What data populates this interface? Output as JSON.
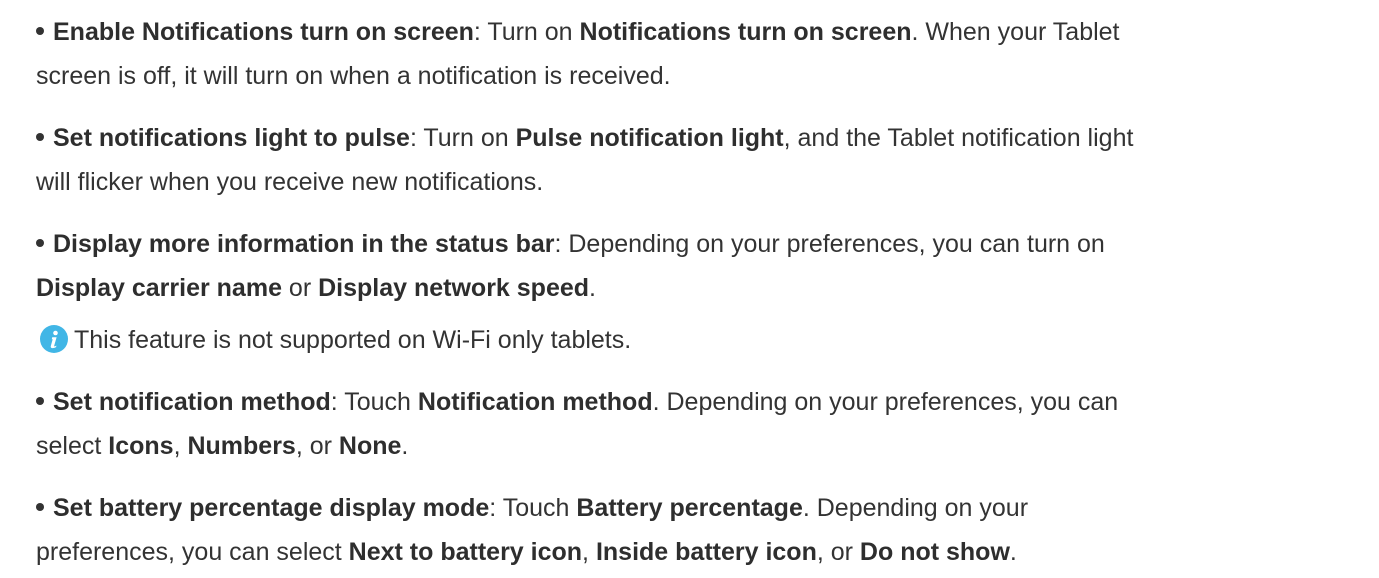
{
  "items": [
    {
      "line1": [
        {
          "t": "Enable Notifications turn on screen",
          "b": true
        },
        {
          "t": ": Turn on ",
          "b": false
        },
        {
          "t": "Notifications turn on screen",
          "b": true
        },
        {
          "t": ". When your Tablet",
          "b": false
        }
      ],
      "line2": [
        {
          "t": "screen is off, it will turn on when a notification is received.",
          "b": false
        }
      ]
    },
    {
      "line1": [
        {
          "t": "Set notifications light to pulse",
          "b": true
        },
        {
          "t": ": Turn on ",
          "b": false
        },
        {
          "t": "Pulse notification light",
          "b": true
        },
        {
          "t": ", and the Tablet notification light",
          "b": false
        }
      ],
      "line2": [
        {
          "t": "will flicker when you receive new notifications.",
          "b": false
        }
      ]
    },
    {
      "line1": [
        {
          "t": "Display more information in the status bar",
          "b": true
        },
        {
          "t": ": Depending on your preferences, you can turn on",
          "b": false
        }
      ],
      "line2": [
        {
          "t": "Display carrier name",
          "b": true
        },
        {
          "t": " or ",
          "b": false
        },
        {
          "t": "Display network speed",
          "b": true
        },
        {
          "t": ".",
          "b": false
        }
      ]
    },
    {
      "line1": [
        {
          "t": "Set notification method",
          "b": true
        },
        {
          "t": ": Touch ",
          "b": false
        },
        {
          "t": "Notification method",
          "b": true
        },
        {
          "t": ". Depending on your preferences, you can",
          "b": false
        }
      ],
      "line2": [
        {
          "t": "select ",
          "b": false
        },
        {
          "t": "Icons",
          "b": true
        },
        {
          "t": ", ",
          "b": false
        },
        {
          "t": "Numbers",
          "b": true
        },
        {
          "t": ", or ",
          "b": false
        },
        {
          "t": "None",
          "b": true
        },
        {
          "t": ".",
          "b": false
        }
      ]
    },
    {
      "line1": [
        {
          "t": "Set battery percentage display mode",
          "b": true
        },
        {
          "t": ": Touch ",
          "b": false
        },
        {
          "t": "Battery percentage",
          "b": true
        },
        {
          "t": ". Depending on your",
          "b": false
        }
      ],
      "line2": [
        {
          "t": "preferences, you can select ",
          "b": false
        },
        {
          "t": "Next to battery icon",
          "b": true
        },
        {
          "t": ", ",
          "b": false
        },
        {
          "t": "Inside battery icon",
          "b": true
        },
        {
          "t": ", or ",
          "b": false
        },
        {
          "t": "Do not show",
          "b": true
        },
        {
          "t": ".",
          "b": false
        }
      ]
    }
  ],
  "note": {
    "icon": "info-icon",
    "color": "#41b6e6",
    "text": "This feature is not supported on Wi-Fi only tablets."
  }
}
